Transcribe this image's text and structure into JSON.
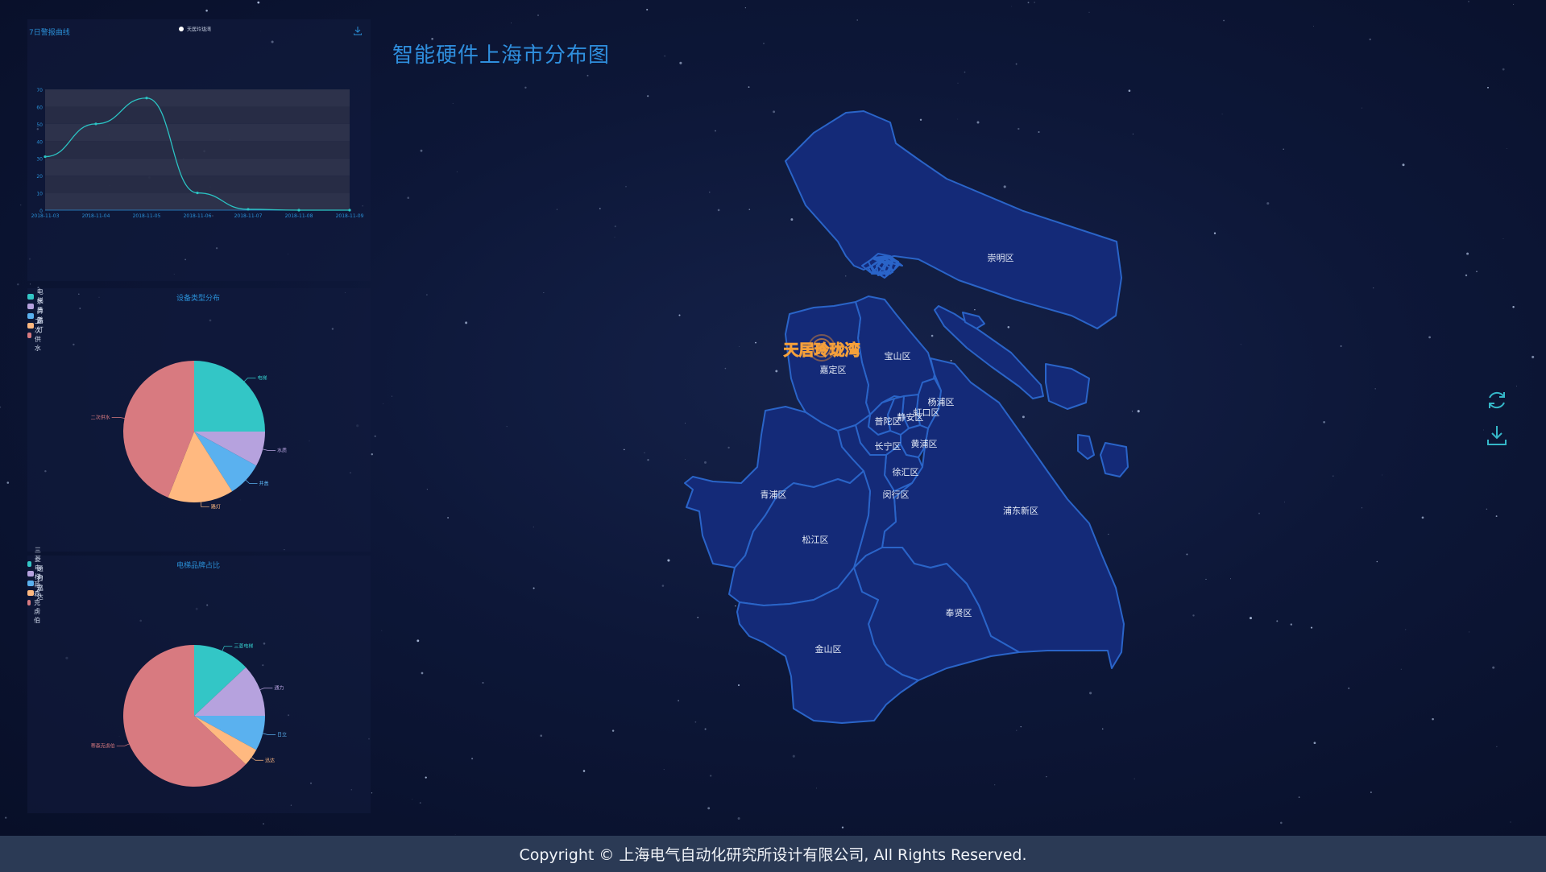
{
  "page": {
    "map_title": "智能硬件上海市分布图",
    "copyright": "Copyright © 上海电气自动化研究所设计有限公司, All Rights Reserved."
  },
  "colors": {
    "district_fill": "#142a78",
    "district_stroke": "#2a64c8",
    "title_blue": "#2f8fde",
    "footer_bg": "#2b3a55",
    "marker_orange": "#f5a03a"
  },
  "line_panel": {
    "title": "7日警报曲线",
    "download_icon": "download-icon",
    "chart_data": {
      "type": "line",
      "title": "7日警报曲线",
      "series": [
        {
          "name": "天居玲珑湾",
          "color": "#2bc4c4",
          "values": [
            31,
            50,
            65,
            10,
            0.5,
            0,
            0
          ]
        }
      ],
      "categories": [
        "2018-11-03",
        "2018-11-04",
        "2018-11-05",
        "2018-11-06",
        "2018-11-07",
        "2018-11-08",
        "2018-11-09"
      ],
      "yticks": [
        "0",
        "10",
        "20",
        "30",
        "40",
        "50",
        "60",
        "70"
      ],
      "ylim": [
        0,
        70
      ],
      "grid": true,
      "legend": "top-center"
    }
  },
  "pie_device": {
    "title": "设备类型分布",
    "chart_data": {
      "type": "pie",
      "title": "设备类型分布",
      "labels": [
        "电梯",
        "水质",
        "井盖",
        "路灯",
        "二次供水"
      ],
      "values": [
        25,
        8,
        8,
        15,
        44
      ],
      "colors": [
        "#33c6c6",
        "#b6a2de",
        "#5ab1ef",
        "#ffb980",
        "#d87a80"
      ],
      "legend": "top-left"
    }
  },
  "pie_elevator": {
    "title": "电梯品牌占比",
    "chart_data": {
      "type": "pie",
      "title": "电梯品牌占比",
      "labels": [
        "三菱电梯",
        "通力",
        "日立",
        "迅达",
        "蒂森克虏伯"
      ],
      "values": [
        13,
        12,
        8,
        4,
        63
      ],
      "colors": [
        "#33c6c6",
        "#b6a2de",
        "#5ab1ef",
        "#ffb980",
        "#d87a80"
      ],
      "legend": "top-left"
    }
  },
  "map": {
    "marker_label": "天居玲珑湾",
    "districts": [
      "崇明区",
      "宝山区",
      "嘉定区",
      "杨浦区",
      "虹口区",
      "普陀区",
      "静安区",
      "长宁区",
      "黄浦区",
      "徐汇区",
      "闵行区",
      "青浦区",
      "浦东新区",
      "松江区",
      "奉贤区",
      "金山区"
    ]
  },
  "tools": {
    "refresh_icon": "refresh-icon",
    "download_icon": "download-icon"
  }
}
